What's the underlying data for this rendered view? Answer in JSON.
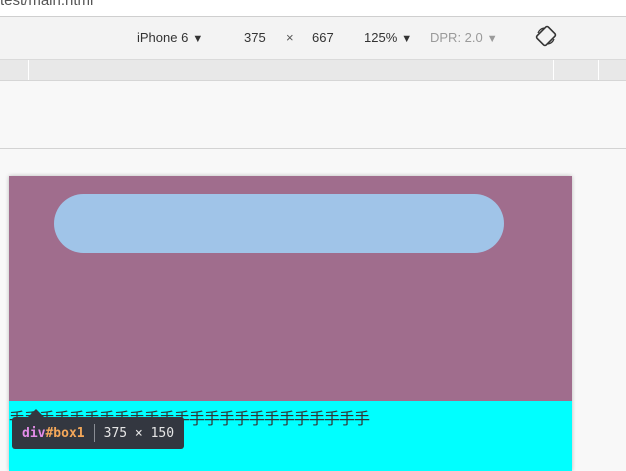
{
  "address_bar": {
    "url_fragment": "test/main.html"
  },
  "device_toolbar": {
    "device": "iPhone 6",
    "width": "375",
    "times": "×",
    "height": "667",
    "zoom": "125%",
    "dpr": "DPR: 2.0",
    "rotate_icon": "rotate-icon"
  },
  "page": {
    "overflow_text": "手手手手手手手手手手手手手手手手手手手手手手手手",
    "colors": {
      "box1": "#a06d8d",
      "pill": "#a0c4e8",
      "box2": "#00ffff"
    }
  },
  "inspector_tooltip": {
    "tag": "div",
    "id": "#box1",
    "dimensions": "375 × 150"
  }
}
